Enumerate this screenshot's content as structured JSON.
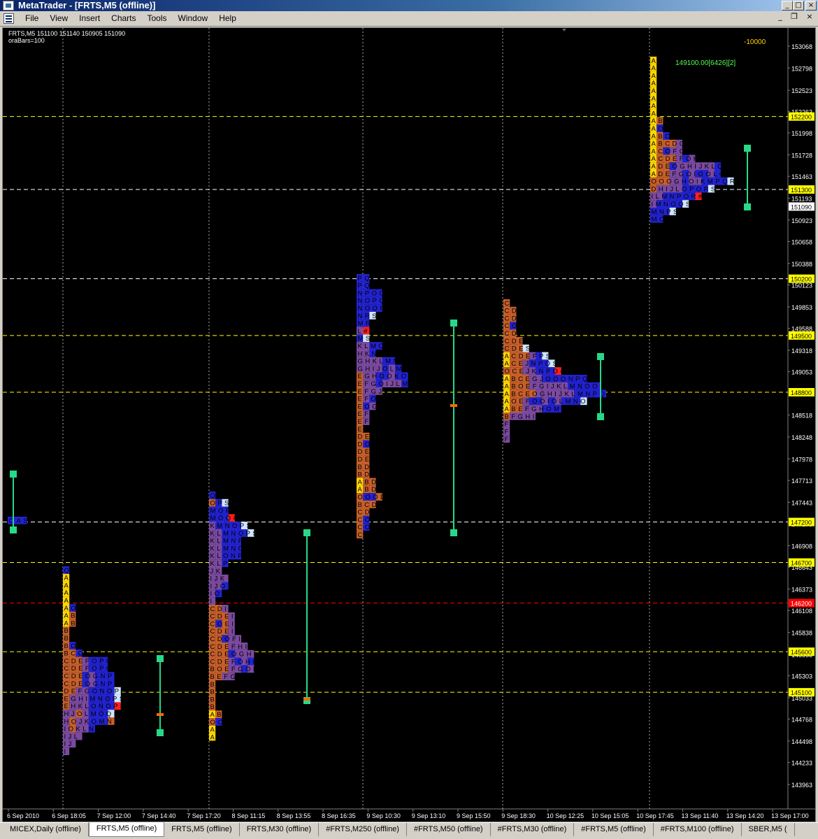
{
  "window": {
    "title": "MetaTrader - [FRTS,M5 (offline)]"
  },
  "menu": [
    "File",
    "View",
    "Insert",
    "Charts",
    "Tools",
    "Window",
    "Help"
  ],
  "chart": {
    "header": "FRTS,M5  151100 151140 150905 151090",
    "subheader": "oraBars=100",
    "corner_value": "-10000",
    "va_label": "149100.00[6426][2]",
    "price_ticks": [
      "153068",
      "152798",
      "152523",
      "152263",
      "151998",
      "151728",
      "151463",
      "151193",
      "150923",
      "150658",
      "150388",
      "150123",
      "149853",
      "149588",
      "149318",
      "149053",
      "148788",
      "148518",
      "148248",
      "147978",
      "147713",
      "147443",
      "147178",
      "146908",
      "146643",
      "146373",
      "146108",
      "145838",
      "145568",
      "145303",
      "145033",
      "144768",
      "144498",
      "144233",
      "143963"
    ],
    "line_labels": [
      {
        "price": "152200",
        "kind": "yellow"
      },
      {
        "price": "151300",
        "kind": "white"
      },
      {
        "price": "151090",
        "kind": "current"
      },
      {
        "price": "150200",
        "kind": "white"
      },
      {
        "price": "149500",
        "kind": "yellow"
      },
      {
        "price": "148800",
        "kind": "yellow"
      },
      {
        "price": "147200",
        "kind": "white"
      },
      {
        "price": "146700",
        "kind": "yellow"
      },
      {
        "price": "146200",
        "kind": "red"
      },
      {
        "price": "145600",
        "kind": "yellow"
      },
      {
        "price": "145100",
        "kind": "yellow"
      }
    ],
    "time_labels": [
      "6 Sep 2010",
      "6 Sep 18:05",
      "7 Sep 12:00",
      "7 Sep 14:40",
      "7 Sep 17:20",
      "8 Sep 11:15",
      "8 Sep 13:55",
      "8 Sep 16:35",
      "9 Sep 10:30",
      "9 Sep 13:10",
      "9 Sep 15:50",
      "9 Sep 18:30",
      "10 Sep 12:25",
      "10 Sep 15:05",
      "10 Sep 17:45",
      "13 Sep 11:40",
      "13 Sep 14:20",
      "13 Sep 17:00"
    ],
    "colors": {
      "background": "#000000",
      "yellow_line": "#ffff00",
      "white_line": "#ffffff",
      "red_line": "#ff0000",
      "letter_a": "#ffd700",
      "letter_early": "#c8602a",
      "letter_mid": "#7b4aa0",
      "letter_late": "#2222d0",
      "range_bar": "#26d988",
      "label_green": "#55ff55"
    },
    "profiles": [
      {
        "rows": [
          "OAS"
        ],
        "base": "blue"
      },
      {
        "rows": [
          "Q",
          "A",
          "A",
          "A",
          "A",
          "AO",
          "AB",
          "AB",
          "B",
          "B",
          "BO",
          "BCO",
          "CDEFOPQ",
          "CDEFOPQ",
          "CDEOGNPQ",
          "CDEOGNPQ",
          "DEFGONOPS",
          "EGHIMNOPS",
          "EHKLONOP#",
          "HJOLMOQS",
          "HOJKOMNB",
          "IOKLN",
          "IJL",
          "IJ",
          "I"
        ]
      },
      {
        "rows": [
          "Q",
          "OPS",
          "MOP",
          "MOQ#",
          "KMNOPS",
          "KLMNOPS",
          "KLMNP",
          "KLMNO",
          "KLONP",
          "KLP",
          "JK",
          "IJK",
          "IJO",
          "IO",
          "I",
          "CDI",
          "CDEI",
          "COEI",
          "CDEI",
          "CDOFI",
          "CDEFHI",
          "CDEOGHI",
          "CDEFOHO",
          "BOEFGOI",
          "BEFG",
          "B",
          "B",
          "B",
          "B",
          "AB",
          "OO",
          "A",
          "A"
        ]
      },
      {
        "rows": [
          "PQ",
          "PQ",
          "NPOQ",
          "NOPQ",
          "NOOR",
          "NRS",
          "MR",
          "L#",
          "MS",
          "KLMO",
          "HKN",
          "GHKLMN",
          "GHIJOLM",
          "EGHOOKOO",
          "EFGOIJLM",
          "EFGJ",
          "EFO",
          "EOG",
          "EF",
          "EF",
          "E",
          "DE",
          "DO",
          "DE",
          "DE",
          "BD",
          "BD",
          "ABD",
          "ABD",
          "OOOD",
          "BCD",
          "CD",
          "CO",
          "CO",
          "C"
        ]
      },
      {
        "rows": [
          "C",
          "CD",
          "CD",
          "CO",
          "CD",
          "CDE",
          "CDES",
          "ACDEFPS",
          "ACEJNPOS",
          "OCEJKNPO#",
          "ABCEGJOOONPQQ",
          "ABOEFGIJKLMNOOR",
          "ABCEOGHIJKLMNPQR",
          "AOEFOOIOLMNOS",
          "ABEFGHOMO",
          "BFGHI",
          "F",
          "F",
          "F"
        ]
      },
      {
        "rows": [
          "A",
          "A",
          "A",
          "A",
          "A",
          "A",
          "A",
          "A",
          "AB",
          "AO",
          "ABO",
          "ABCDG",
          "ACOFG",
          "ACDEFOK",
          "ADEOGHIJKLQ",
          "ADEFGOIOOLO",
          "OOOGHOIKMPQRS",
          "DHIJLOPORS",
          "ILMNPOR#",
          "IMNOQS",
          "MNPS",
          "MO"
        ]
      }
    ]
  },
  "tabs": [
    "MICEX,Daily (offline)",
    "FRTS,M5 (offline)",
    "FRTS,M5 (offline)",
    "FRTS,M30 (offline)",
    "#FRTS,M250 (offline)",
    "#FRTS,M50 (offline)",
    "#FRTS,M30 (offline)",
    "#FRTS,M5 (offline)",
    "#FRTS,M100 (offline)",
    "SBER,M5 ("
  ],
  "active_tab": 1
}
